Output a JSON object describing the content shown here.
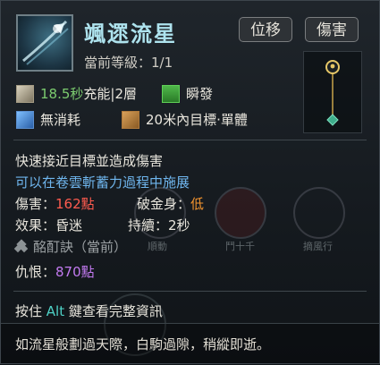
{
  "skill": {
    "name": "颯遝流星",
    "tags": [
      "位移",
      "傷害"
    ],
    "level_label": "當前等級：",
    "level_value": "1/1"
  },
  "stats": {
    "charge_time": "18.5秒",
    "charge_suffix": "充能|2層",
    "cast_type": "瞬發",
    "cost": "無消耗",
    "range": "20米內目標·單體"
  },
  "description": {
    "line1": "快速接近目標並造成傷害",
    "line2": "可以在卷雲斬蓄力過程中施展"
  },
  "attributes": {
    "damage_label": "傷害：",
    "damage_value": "162點",
    "armor_break_label": "破金身：",
    "armor_break_value": "低",
    "effect_label": "效果：",
    "effect_value": "昏迷",
    "duration_label": "持續：",
    "duration_value": "2秒",
    "formula_label": "酩酊訣（當前）",
    "hatred_label": "仇恨：",
    "hatred_value": "870點"
  },
  "hint": {
    "prefix": "按住 ",
    "key": "Alt",
    "suffix": " 鍵查看完整資訊"
  },
  "flavor": "如流星般劃過天際，白駒過隙，稍縱即逝。",
  "background_text": [
    "順動",
    "鬥十千",
    "摘風行"
  ],
  "colors": {
    "title": "#aee3ee",
    "charge": "#7ccc6f",
    "damage": "#ff5b4f",
    "low": "#f4942e",
    "hatred": "#c27af0",
    "sub": "#6fb6ee",
    "key": "#4ed1c6"
  },
  "icons": [
    "skill-icon",
    "clock-icon",
    "green-charge-icon",
    "blue-cost-icon",
    "range-shield-icon",
    "diamond-icon",
    "track-node-icon"
  ]
}
